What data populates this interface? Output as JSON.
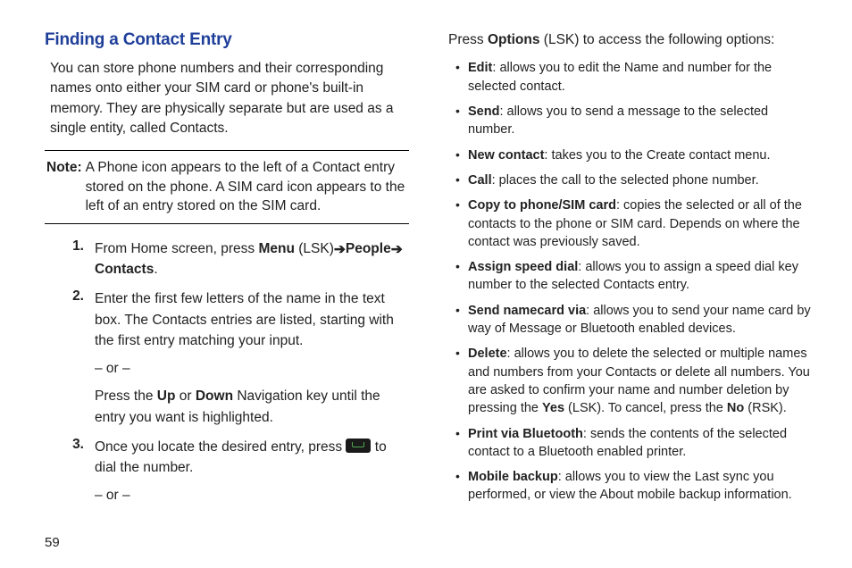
{
  "heading": "Finding a Contact Entry",
  "intro": "You can store phone numbers and their corresponding names onto either your SIM card or phone's built-in memory. They are physically separate but are used as a single entity, called Contacts.",
  "note_label": "Note:",
  "note_text": "A Phone icon appears to the left of a Contact entry stored on the phone. A SIM card icon appears to the left of an entry stored on the SIM card.",
  "step1": {
    "prefix": "From Home screen, press ",
    "menu": "Menu",
    "lsk": " (LSK)",
    "arrow1": " ➔ ",
    "people": "People",
    "arrow2": " ➔ ",
    "contacts": "Contacts",
    "period": "."
  },
  "step2": {
    "p1": "Enter the first few letters of the name in the text box. The Contacts entries are listed, starting with the first entry matching your input.",
    "or": "– or –",
    "p2a": "Press the ",
    "up": "Up",
    "p2b": " or ",
    "down": "Down",
    "p2c": " Navigation key until the entry you want is highlighted."
  },
  "step3": {
    "p1a": "Once you locate the desired entry, press ",
    "p1b": " to dial the number.",
    "or": "– or –"
  },
  "right_intro_a": "Press ",
  "right_intro_b": "Options",
  "right_intro_c": " (LSK) to access the following options:",
  "options": {
    "edit": {
      "name": "Edit",
      "desc": ": allows you to edit the Name and number for the selected contact."
    },
    "send": {
      "name": "Send",
      "desc": ": allows you to send a message to the selected number."
    },
    "newcontact": {
      "name": "New contact",
      "desc": ": takes you to the Create contact menu."
    },
    "call": {
      "name": "Call",
      "desc": ": places the call to the selected phone number."
    },
    "copy": {
      "name": "Copy to phone/SIM card",
      "desc": ": copies the selected or all of the contacts to the phone or SIM card. Depends on where the contact was previously saved."
    },
    "speed": {
      "name": "Assign speed dial",
      "desc": ": allows you to assign a speed dial key number to the selected Contacts entry."
    },
    "namecard": {
      "name": "Send namecard via",
      "desc": ": allows you to send your name card by way of Message or Bluetooth enabled devices."
    },
    "delete": {
      "name": "Delete",
      "pa": ": allows you to delete the selected or multiple names and numbers from your Contacts or delete all numbers. You are asked to confirm your name and number deletion by pressing the ",
      "yes": "Yes",
      "pb": " (LSK). To cancel, press the ",
      "no": "No",
      "pc": " (RSK)."
    },
    "print": {
      "name": "Print via Bluetooth",
      "desc": ": sends the contents of the selected contact to a Bluetooth enabled printer."
    },
    "backup": {
      "name": "Mobile backup",
      "desc": ": allows you to view the Last sync you performed, or view the About mobile backup information."
    }
  },
  "page": "59"
}
